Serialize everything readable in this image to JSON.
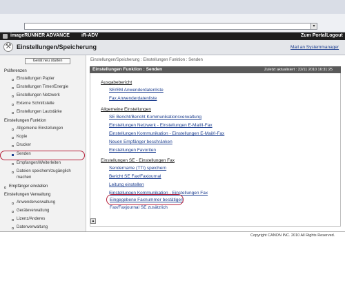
{
  "browser": {
    "address_value": "",
    "dropdown_glyph": "▾"
  },
  "header": {
    "app_title": "imageRUNNER ADVANCE",
    "device": "iR-ADV",
    "portal": "Zum Portal",
    "logout": "Logout"
  },
  "page": {
    "title": "Einstellungen/Speicherung",
    "mail_link": "Mail an Systemmanager",
    "icon": "settings-wrench-icon"
  },
  "sidebar": {
    "home_button": "Gerät neu starten",
    "groups": [
      {
        "label": "Präferenzen",
        "items": [
          {
            "label": "Einstellungen Papier"
          },
          {
            "label": "Einstellungen Timer/Energie"
          },
          {
            "label": "Einstellungen Netzwerk"
          },
          {
            "label": "Externe Schnittstelle"
          },
          {
            "label": "Einstellungen Lautstärke"
          }
        ]
      },
      {
        "label": "Einstellungen Funktion",
        "items": [
          {
            "label": "Allgemeine Einstellungen"
          },
          {
            "label": "Kopie"
          },
          {
            "label": "Drucker"
          },
          {
            "label": "Senden"
          },
          {
            "label": "Empfangen/Weiterleiten"
          },
          {
            "label": "Dateien speichern/zugänglich"
          },
          {
            "label": "machen"
          }
        ]
      },
      {
        "label": "Empfänger einstellen",
        "items": []
      },
      {
        "label": "Einstellungen Verwaltung",
        "items": [
          {
            "label": "Anwenderverwaltung"
          },
          {
            "label": "Geräteverwaltung"
          },
          {
            "label": "Lizenz/Anderes"
          },
          {
            "label": "Datenverwaltung"
          }
        ]
      }
    ]
  },
  "main": {
    "breadcrumb": "Einstellungen/Speicherung : Einstellungen Funktion : Senden",
    "panel_title": "Einstellungen Funktion : Senden",
    "updated": "Zuletzt aktualisiert : 22/11 2010 16:31:25",
    "sections": [
      {
        "title": "Ausgabebericht",
        "links": [
          "SE/EM Anwenderdatenliste",
          "Fax Anwenderdatenliste"
        ]
      },
      {
        "title": "Allgemeine Einstellungen",
        "links": [
          "SE Bericht/Bericht Kommunikationsverwaltung",
          "Einstellungen Netzwerk - Einstellungen E-Mail/I-Fax",
          "Einstellungen Kommunikation - Einstellungen E-Mail/I-Fax",
          "Neuen Empfänger beschränken",
          "Einstellungen Favoriten"
        ]
      },
      {
        "title": "Einstellungen SE - Einstellungen Fax",
        "links": [
          "Sendername (TTI) speichern",
          "Bericht SE Fax/Faxjournal",
          "Leitung einstellen",
          "Einstellungen Kommunikation - Einstellungen Fax",
          "Eingegebene Faxnummer bestätigen",
          "Fax/Faxjournal SE zusätzlich"
        ]
      }
    ],
    "up_icon": "arrow-up-icon"
  },
  "footer": {
    "copyright": "Copyright CANON INC. 2010 All Rights Reserved."
  },
  "colors": {
    "highlight": "#b6203a",
    "link": "#1b3d8f",
    "header_bg": "#1e1e1e",
    "panel_bg": "#5a5a5a"
  }
}
